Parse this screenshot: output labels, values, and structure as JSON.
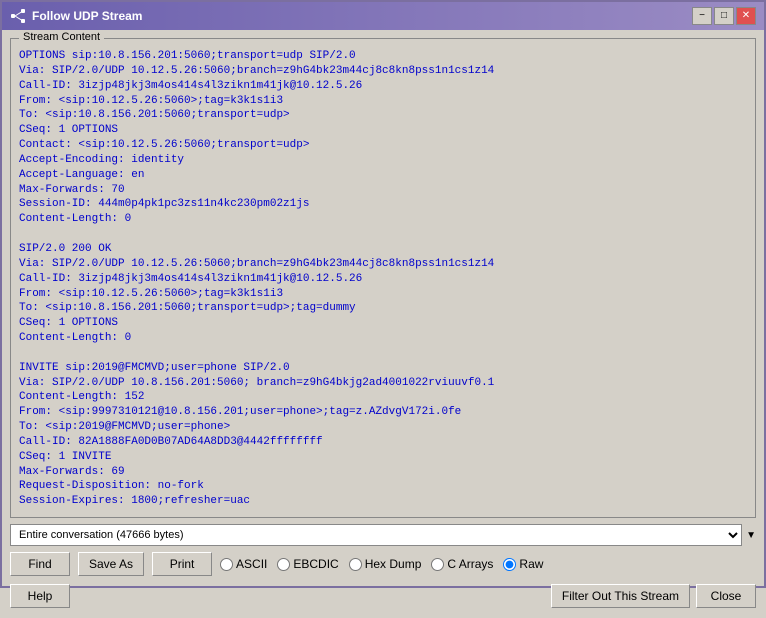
{
  "window": {
    "title": "Follow UDP Stream",
    "icon": "network-icon"
  },
  "title_buttons": {
    "minimize": "−",
    "maximize": "□",
    "close": "✕"
  },
  "stream_content": {
    "label": "Stream Content",
    "text": "OPTIONS sip:10.8.156.201:5060;transport=udp SIP/2.0\nVia: SIP/2.0/UDP 10.12.5.26:5060;branch=z9hG4bk23m44cj8c8kn8pss1n1cs1z14\nCall-ID: 3izjp48jkj3m4os414s4l3zikn1m41jk@10.12.5.26\nFrom: <sip:10.12.5.26:5060>;tag=k3k1s1i3\nTo: <sip:10.8.156.201:5060;transport=udp>\nCSeq: 1 OPTIONS\nContact: <sip:10.12.5.26:5060;transport=udp>\nAccept-Encoding: identity\nAccept-Language: en\nMax-Forwards: 70\nSession-ID: 444m0p4pk1pc3zs11n4kc230pm02z1js\nContent-Length: 0\n\nSIP/2.0 200 OK\nVia: SIP/2.0/UDP 10.12.5.26:5060;branch=z9hG4bk23m44cj8c8kn8pss1n1cs1z14\nCall-ID: 3izjp48jkj3m4os414s4l3zikn1m41jk@10.12.5.26\nFrom: <sip:10.12.5.26:5060>;tag=k3k1s1i3\nTo: <sip:10.8.156.201:5060;transport=udp>;tag=dummy\nCSeq: 1 OPTIONS\nContent-Length: 0\n\nINVITE sip:2019@FMCMVD;user=phone SIP/2.0\nVia: SIP/2.0/UDP 10.8.156.201:5060; branch=z9hG4bkjg2ad4001022rviuuvf0.1\nContent-Length: 152\nFrom: <sip:9997310121@10.8.156.201;user=phone>;tag=z.AZdvgV172i.0fe\nTo: <sip:2019@FMCMVD;user=phone>\nCall-ID: 82A1888FA0D0B07AD64A8DD3@4442ffffffff\nCSeq: 1 INVITE\nMax-Forwards: 69\nRequest-Disposition: no-fork\nSession-Expires: 1800;refresher=uac"
  },
  "dropdown": {
    "value": "Entire conversation (47666 bytes)",
    "options": [
      "Entire conversation (47666 bytes)"
    ]
  },
  "buttons": {
    "find": "Find",
    "save_as": "Save As",
    "print": "Print",
    "help": "Help",
    "filter_out": "Filter Out This Stream",
    "close": "Close"
  },
  "radio_group": {
    "options": [
      "ASCII",
      "EBCDIC",
      "Hex Dump",
      "C Arrays",
      "Raw"
    ],
    "selected": "Raw"
  }
}
